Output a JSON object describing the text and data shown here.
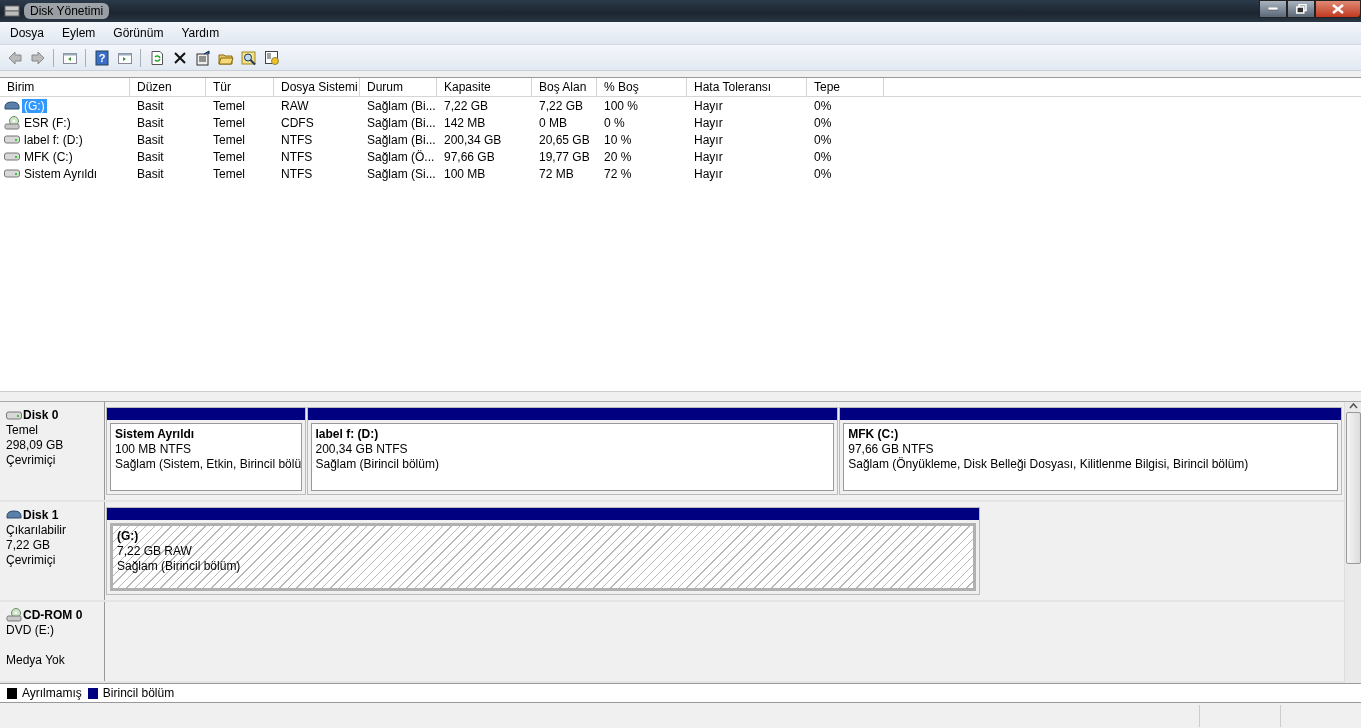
{
  "window": {
    "title": "Disk Yönetimi"
  },
  "menu": [
    "Dosya",
    "Eylem",
    "Görünüm",
    "Yardım"
  ],
  "toolbar": {
    "help_glyph": "?"
  },
  "table": {
    "columns": [
      "Birim",
      "Düzen",
      "Tür",
      "Dosya Sistemi",
      "Durum",
      "Kapasite",
      "Boş Alan",
      "% Boş",
      "Hata Toleransı",
      "Tepe"
    ],
    "rows": [
      {
        "kind": "removable",
        "selected": true,
        "cells": [
          " (G:)",
          "Basit",
          "Temel",
          "RAW",
          "Sağlam (Bi...",
          "7,22 GB",
          "7,22 GB",
          "100 %",
          "Hayır",
          "0%"
        ]
      },
      {
        "kind": "cdrom",
        "selected": false,
        "cells": [
          "ESR (F:)",
          "Basit",
          "Temel",
          "CDFS",
          "Sağlam (Bi...",
          "142 MB",
          "0 MB",
          "0 %",
          "Hayır",
          "0%"
        ]
      },
      {
        "kind": "disk",
        "selected": false,
        "cells": [
          "label f: (D:)",
          "Basit",
          "Temel",
          "NTFS",
          "Sağlam (Bi...",
          "200,34 GB",
          "20,65 GB",
          "10 %",
          "Hayır",
          "0%"
        ]
      },
      {
        "kind": "disk",
        "selected": false,
        "cells": [
          "MFK (C:)",
          "Basit",
          "Temel",
          "NTFS",
          "Sağlam (Ö...",
          "97,66 GB",
          "19,77 GB",
          "20 %",
          "Hayır",
          "0%"
        ]
      },
      {
        "kind": "disk",
        "selected": false,
        "cells": [
          "Sistem Ayrıldı",
          "Basit",
          "Temel",
          "NTFS",
          "Sağlam (Si...",
          "100 MB",
          "72 MB",
          "72 %",
          "Hayır",
          "0%"
        ]
      }
    ]
  },
  "disks": [
    {
      "kind": "disk",
      "name": "Disk 0",
      "lines": [
        "Temel",
        "298,09 GB",
        "Çevrimiçi"
      ],
      "partitions": [
        {
          "name": "Sistem Ayrıldı",
          "size": "100 MB NTFS",
          "status": "Sağlam (Sistem, Etkin, Birincil bölü",
          "selected": false
        },
        {
          "name": "label f:  (D:)",
          "size": "200,34 GB NTFS",
          "status": "Sağlam (Birincil bölüm)",
          "selected": false
        },
        {
          "name": "MFK  (C:)",
          "size": "97,66 GB NTFS",
          "status": "Sağlam (Önyükleme, Disk Belleği Dosyası, Kilitlenme Bilgisi, Birincil bölüm)",
          "selected": false
        }
      ]
    },
    {
      "kind": "removable",
      "name": "Disk 1",
      "lines": [
        "Çıkarılabilir",
        "7,22 GB",
        "Çevrimiçi"
      ],
      "partitions": [
        {
          "name": " (G:)",
          "size": "7,22 GB RAW",
          "status": "Sağlam (Birincil bölüm)",
          "selected": true
        }
      ]
    },
    {
      "kind": "cdrom",
      "name": "CD-ROM 0",
      "lines": [
        "DVD (E:)",
        "Medya Yok"
      ]
    }
  ],
  "legend": [
    {
      "label": "Ayrılmamış",
      "color": "#000000"
    },
    {
      "label": "Birincil bölüm",
      "color": "#000080"
    }
  ]
}
